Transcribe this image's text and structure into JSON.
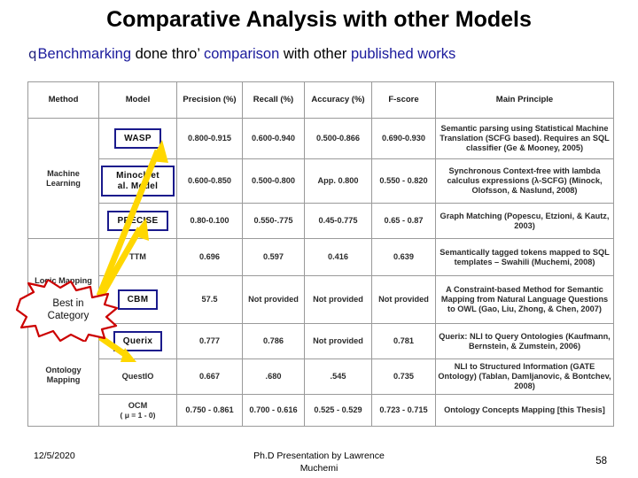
{
  "slide": {
    "title": "Comparative Analysis  with other Models",
    "subtitle": {
      "bullet": "q",
      "part1": "Benchmarking",
      "part2": " done thro’ ",
      "part3": "comparison",
      "part4": " with other ",
      "part5": "published works"
    },
    "callout": {
      "line1": "Best in",
      "line2": "Category"
    },
    "footer": {
      "date": "12/5/2020",
      "center_line1": "Ph.D Presentation by Lawrence",
      "center_line2": "Muchemi",
      "page": "58"
    }
  },
  "table": {
    "headers": [
      "Method",
      "Model",
      "Precision (%)",
      "Recall (%)",
      "Accuracy (%)",
      "F-score",
      "Main Principle"
    ],
    "group_labels": {
      "ml": "Machine Learning",
      "logic": "Logic Mapping",
      "ontology": "Ontology Mapping"
    },
    "rows": [
      {
        "model": "WASP",
        "boxed": true,
        "precision": "0.800-0.915",
        "recall": "0.600-0.940",
        "accuracy": "0.500-0.866",
        "fscore": "0.690-0.930",
        "principle": "Semantic parsing using Statistical Machine Translation (SCFG based). Requires an SQL classifier (Ge & Mooney, 2005)"
      },
      {
        "model": "Minock et al. Model",
        "boxed": true,
        "precision": "0.600-0.850",
        "recall": "0.500-0.800",
        "accuracy": "App. 0.800",
        "fscore": "0.550 - 0.820",
        "principle": "Synchronous Context-free with lambda calculus expressions (λ-SCFG) (Minock, Olofsson, & Naslund, 2008)"
      },
      {
        "model": "PRECISE",
        "boxed": true,
        "precision": "0.80-0.100",
        "recall": "0.550-.775",
        "accuracy": "0.45-0.775",
        "fscore": "0.65 - 0.87",
        "principle": "Graph Matching (Popescu, Etzioni, & Kautz, 2003)"
      },
      {
        "model": "TTM",
        "boxed": false,
        "precision": "0.696",
        "recall": "0.597",
        "accuracy": "0.416",
        "fscore": "0.639",
        "principle": "Semantically tagged tokens mapped to  SQL templates – Swahili (Muchemi, 2008)"
      },
      {
        "model": "CBM",
        "boxed": true,
        "precision": "57.5",
        "recall": "Not provided",
        "accuracy": "Not provided",
        "fscore": "Not provided",
        "principle": "A Constraint-based Method for Semantic Mapping from Natural Language Questions to OWL (Gao, Liu, Zhong, & Chen, 2007)"
      },
      {
        "model": "Querix",
        "boxed": true,
        "precision": "0.777",
        "recall": "0.786",
        "accuracy": "Not provided",
        "fscore": "0.781",
        "principle": "Querix: NLI to Query Ontologies (Kaufmann, Bernstein, & Zumstein, 2006)"
      },
      {
        "model": "QuestIO",
        "boxed": false,
        "precision": "0.667",
        "recall": ".680",
        "accuracy": ".545",
        "fscore": "0.735",
        "principle": "NLI to Structured Information (GATE Ontology) (Tablan, Damljanovic, & Bontchev, 2008)"
      },
      {
        "model": "OCM",
        "model_sub": "( μ = 1 - 0)",
        "boxed": false,
        "precision": "0.750 - 0.861",
        "recall": "0.700 - 0.616",
        "accuracy": "0.525 - 0.529",
        "fscore": "0.723 - 0.715",
        "principle": "Ontology Concepts Mapping [this Thesis]"
      }
    ]
  },
  "colors": {
    "accent_blue": "#1a1a9c",
    "star_border": "#cc0000",
    "arrow_yellow": "#ffd700",
    "box_border": "#1a1a8c"
  }
}
